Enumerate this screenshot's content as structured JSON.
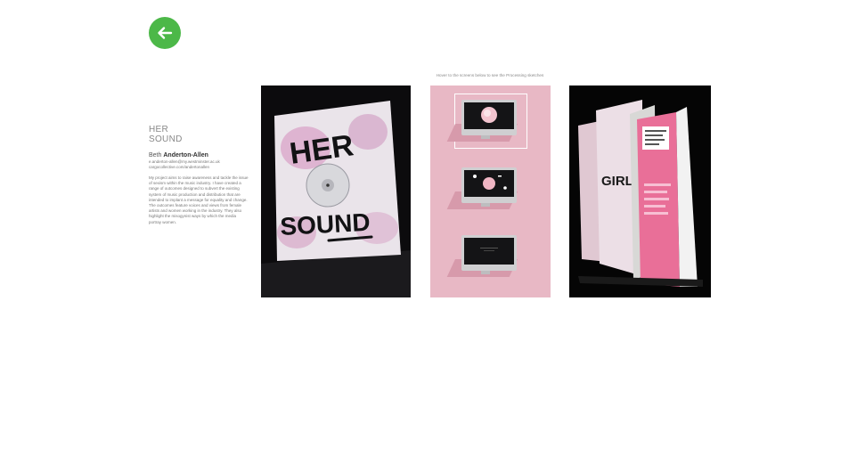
{
  "nav": {
    "back_icon": "arrow-left-icon",
    "accent_color": "#4cb848"
  },
  "project": {
    "title_line1": "HER",
    "title_line2": "SOUND",
    "author_first": "Beth",
    "author_last": "Anderton-Allen",
    "email": "e.anderton-allen@my.westminster.ac.uk",
    "portfolio": "cargocollective.com/andertonallen",
    "description": "My project aims to raise awareness and tackle the issue of sexism within the music industry. I have created a range of outcomes designed to subvert the existing system of music production and distribution that are intended to implant a message for equality and change. The outcomes feature voices and views from female artists and women working in the industry. They also highlight the misogynist ways by which the media portray women."
  },
  "gallery": {
    "hint": "Hover to the screens below to see the Processing sketches",
    "vinyl_text_top": "HER",
    "vinyl_text_bottom": "SOUND",
    "booklet_text": "GIRLISH",
    "screens": [
      {
        "name": "sketch-1",
        "active": true
      },
      {
        "name": "sketch-2",
        "active": false
      },
      {
        "name": "sketch-3",
        "active": false
      }
    ],
    "colors": {
      "pink_panel": "#e8b8c5",
      "dark_panel": "#0c0b0d"
    }
  }
}
